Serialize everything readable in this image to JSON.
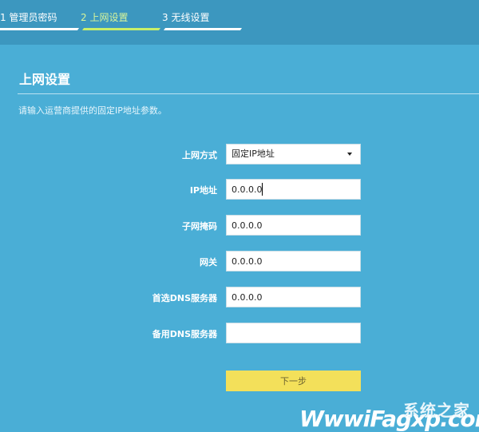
{
  "wizard": {
    "steps": [
      {
        "label": "1 管理员密码"
      },
      {
        "label": "2 上网设置"
      },
      {
        "label": "3 无线设置"
      }
    ]
  },
  "page": {
    "title": "上网设置",
    "description": "请输入运营商提供的固定IP地址参数。"
  },
  "form": {
    "connection_type": {
      "label": "上网方式",
      "value": "固定IP地址"
    },
    "ip_address": {
      "label": "IP地址",
      "value": "0.0.0.0"
    },
    "subnet_mask": {
      "label": "子网掩码",
      "value": "0.0.0.0"
    },
    "gateway": {
      "label": "网关",
      "value": "0.0.0.0"
    },
    "primary_dns": {
      "label": "首选DNS服务器",
      "value": "0.0.0.0"
    },
    "secondary_dns": {
      "label": "备用DNS服务器",
      "value": ""
    }
  },
  "actions": {
    "next_label": "下一步"
  },
  "watermark": {
    "text_cn": "系统之家",
    "text_en": "WwwiFagxp.com"
  },
  "colors": {
    "background": "#4aaed6",
    "topbar": "#3c97bf",
    "active_step": "#c8ef6a",
    "next_button": "#f3e05a"
  }
}
